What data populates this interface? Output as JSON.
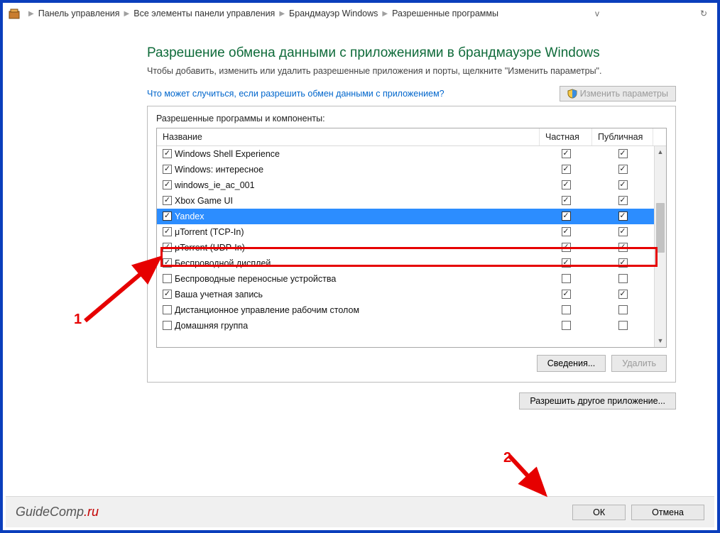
{
  "breadcrumbs": {
    "segs": [
      "Панель управления",
      "Все элементы панели управления",
      "Брандмауэр Windows",
      "Разрешенные программы"
    ]
  },
  "title": "Разрешение обмена данными с приложениями в брандмауэре Windows",
  "desc": "Чтобы добавить, изменить или удалить разрешенные приложения и порты, щелкните \"Изменить параметры\".",
  "risk_link": "Что может случиться, если разрешить обмен данными с приложением?",
  "buttons": {
    "change_params": "Изменить параметры",
    "details": "Сведения...",
    "remove": "Удалить",
    "allow_other": "Разрешить другое приложение...",
    "ok": "ОК",
    "cancel": "Отмена"
  },
  "panel_label": "Разрешенные программы и компоненты:",
  "columns": {
    "name": "Название",
    "private": "Частная",
    "public": "Публичная"
  },
  "rows": [
    {
      "name": "Windows Shell Experience",
      "enabled": true,
      "private": true,
      "public": true,
      "selected": false
    },
    {
      "name": "Windows: интересное",
      "enabled": true,
      "private": true,
      "public": true,
      "selected": false
    },
    {
      "name": "windows_ie_ac_001",
      "enabled": true,
      "private": true,
      "public": true,
      "selected": false
    },
    {
      "name": "Xbox Game UI",
      "enabled": true,
      "private": true,
      "public": true,
      "selected": false
    },
    {
      "name": "Yandex",
      "enabled": true,
      "private": true,
      "public": true,
      "selected": true
    },
    {
      "name": "μTorrent (TCP-In)",
      "enabled": true,
      "private": true,
      "public": true,
      "selected": false
    },
    {
      "name": "μTorrent (UDP-In)",
      "enabled": true,
      "private": true,
      "public": true,
      "selected": false
    },
    {
      "name": "Беспроводной дисплей",
      "enabled": true,
      "private": true,
      "public": true,
      "selected": false
    },
    {
      "name": "Беспроводные переносные устройства",
      "enabled": false,
      "private": false,
      "public": false,
      "selected": false
    },
    {
      "name": "Ваша учетная запись",
      "enabled": true,
      "private": true,
      "public": true,
      "selected": false
    },
    {
      "name": "Дистанционное управление рабочим столом",
      "enabled": false,
      "private": false,
      "public": false,
      "selected": false
    },
    {
      "name": "Домашняя группа",
      "enabled": false,
      "private": false,
      "public": false,
      "selected": false
    }
  ],
  "watermark": {
    "a": "GuideComp",
    "b": ".ru"
  },
  "markers": {
    "m1": "1",
    "m2": "2"
  }
}
